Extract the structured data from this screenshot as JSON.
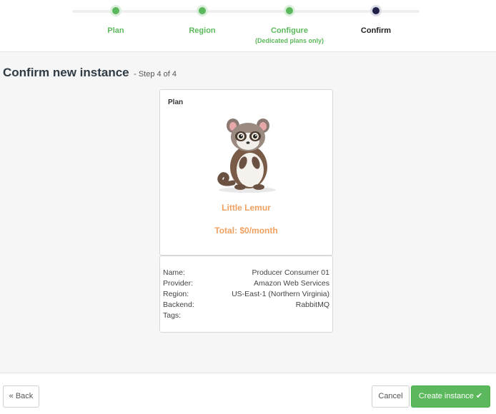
{
  "wizard": {
    "steps": [
      {
        "label": "Plan",
        "sub": "",
        "state": "done"
      },
      {
        "label": "Region",
        "sub": "",
        "state": "done"
      },
      {
        "label": "Configure",
        "sub": "(Dedicated plans only)",
        "state": "done"
      },
      {
        "label": "Confirm",
        "sub": "",
        "state": "active"
      }
    ]
  },
  "heading": {
    "title": "Confirm new instance",
    "step_text": "- Step 4 of 4"
  },
  "plan": {
    "card_title": "Plan",
    "name": "Little Lemur",
    "total": "Total: $0/month",
    "accent_color": "#f0a060"
  },
  "details": [
    {
      "label": "Name:",
      "value": "Producer Consumer 01"
    },
    {
      "label": "Provider:",
      "value": "Amazon Web Services"
    },
    {
      "label": "Region:",
      "value": "US-East-1 (Northern Virginia)"
    },
    {
      "label": "Backend:",
      "value": "RabbitMQ"
    },
    {
      "label": "Tags:",
      "value": ""
    }
  ],
  "footer": {
    "back_label": "« Back",
    "cancel_label": "Cancel",
    "create_label": "Create instance",
    "create_icon": "check-icon"
  },
  "colors": {
    "success": "#5cb85c",
    "active_step": "#1f1f47"
  }
}
